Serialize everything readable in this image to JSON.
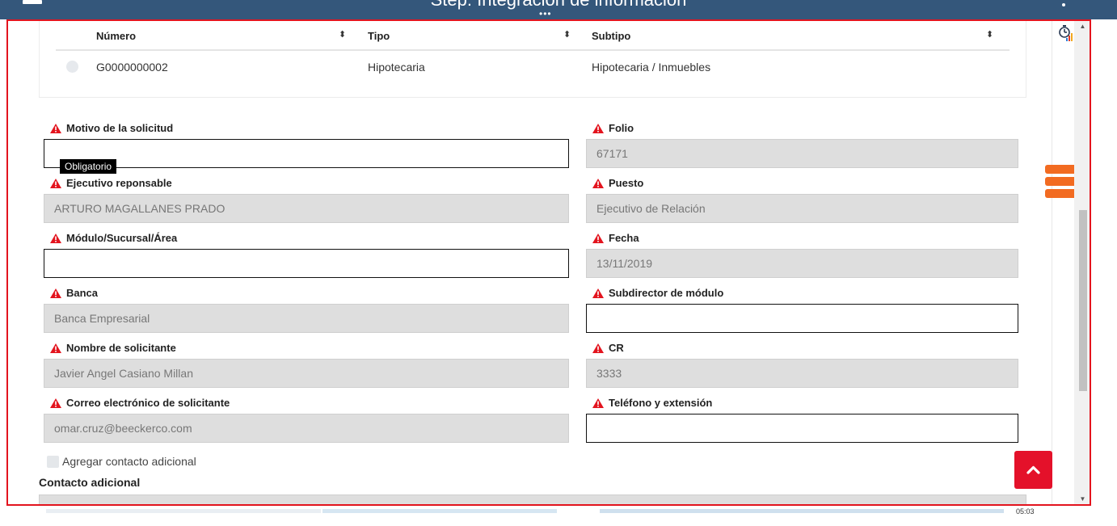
{
  "app": {
    "title": "Step: Integración de información",
    "dots": "•••"
  },
  "table": {
    "headers": [
      "Número",
      "Tipo",
      "Subtipo"
    ],
    "sort_glyph": "⬍",
    "rows": [
      {
        "numero": "G0000000002",
        "tipo": "Hipotecaria",
        "subtipo": "Hipotecaria / Inmuebles"
      }
    ]
  },
  "form": {
    "tooltip": "Obligatorio",
    "fields": {
      "motivo": {
        "label": "Motivo de la solicitud",
        "value": ""
      },
      "folio": {
        "label": "Folio",
        "value": "67171"
      },
      "ejecutivo": {
        "label": "Ejecutivo reponsable",
        "value": "ARTURO MAGALLANES PRADO"
      },
      "puesto": {
        "label": "Puesto",
        "value": "Ejecutivo de Relación"
      },
      "modulo": {
        "label": "Módulo/Sucursal/Área",
        "value": ""
      },
      "fecha": {
        "label": "Fecha",
        "value": "13/11/2019"
      },
      "banca": {
        "label": "Banca",
        "value": "Banca Empresarial"
      },
      "subdirector": {
        "label": "Subdirector de módulo",
        "value": ""
      },
      "nombre": {
        "label": "Nombre de solicitante",
        "value": "Javier Angel Casiano Millan"
      },
      "cr": {
        "label": "CR",
        "value": "3333"
      },
      "correo": {
        "label": "Correo electrónico de solicitante",
        "value": "omar.cruz@beeckerco.com"
      },
      "telefono": {
        "label": "Teléfono y extensión",
        "value": ""
      }
    },
    "checkbox_label": "Agregar contacto adicional",
    "section_title": "Contacto adicional"
  },
  "taskbar": {
    "time": "05:03"
  },
  "colors": {
    "topbar": "#34577b",
    "frame": "#e3141e",
    "warning": "#e3141e",
    "menu_button": "#f26b21",
    "scroll_top_button": "#e4112a"
  },
  "icons": [
    "menu-icon",
    "kebab-icon",
    "warning-icon",
    "sort-icon",
    "timer-chart-icon",
    "list-menu-icon",
    "chevron-up-icon"
  ]
}
